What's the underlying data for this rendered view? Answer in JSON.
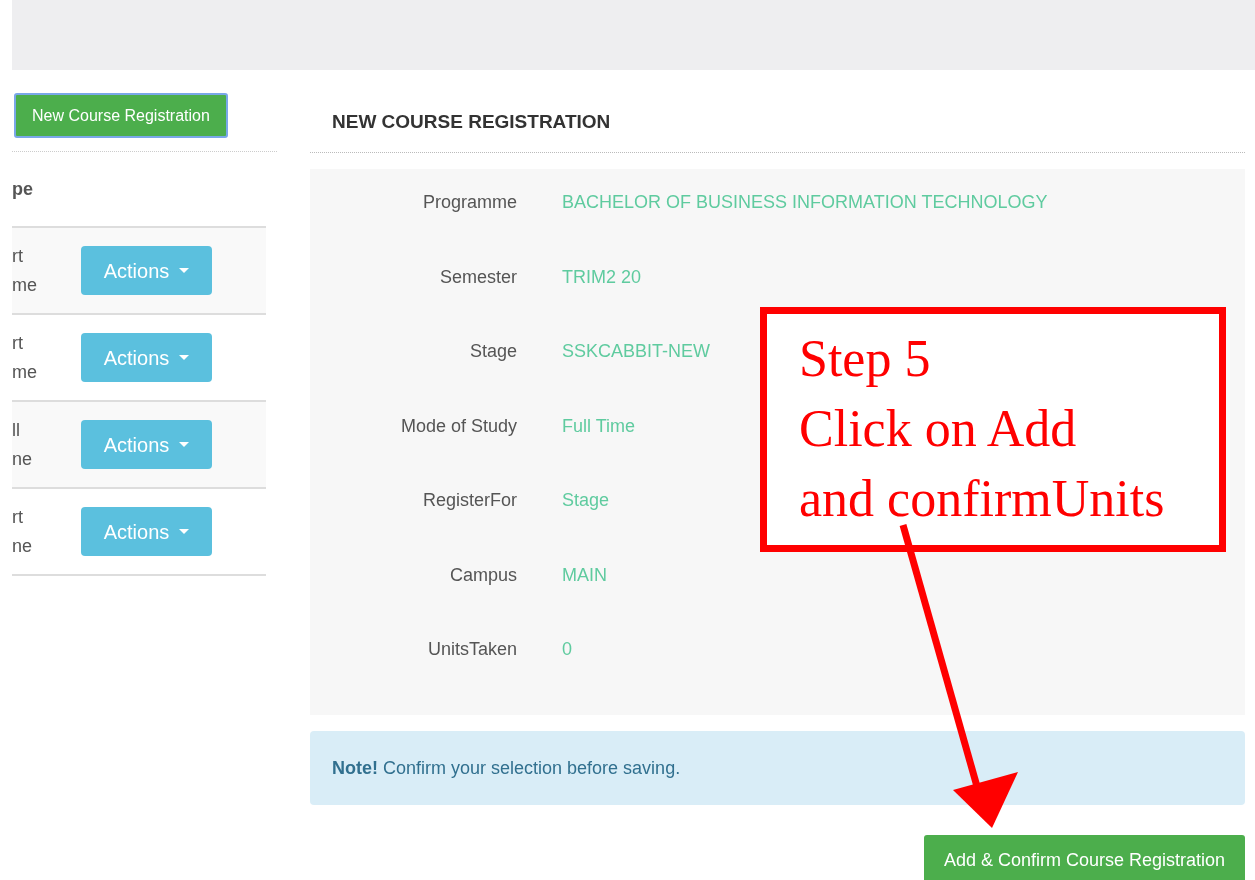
{
  "sidebar": {
    "new_button": "New Course Registration",
    "table": {
      "columns": [
        "pe"
      ],
      "rows": [
        {
          "lines": [
            "rt",
            "me"
          ],
          "action": "Actions"
        },
        {
          "lines": [
            "rt",
            "me"
          ],
          "action": "Actions"
        },
        {
          "lines": [
            "ll",
            "ne"
          ],
          "action": "Actions"
        },
        {
          "lines": [
            "rt",
            "ne"
          ],
          "action": "Actions"
        }
      ]
    }
  },
  "panel": {
    "title": "NEW COURSE REGISTRATION",
    "fields": [
      {
        "label": "Programme",
        "value": "BACHELOR OF BUSINESS INFORMATION TECHNOLOGY"
      },
      {
        "label": "Semester",
        "value": "TRIM2 20"
      },
      {
        "label": "Stage",
        "value": "SSKCABBIT-NEW"
      },
      {
        "label": "Mode of Study",
        "value": "Full Time"
      },
      {
        "label": "RegisterFor",
        "value": "Stage"
      },
      {
        "label": "Campus",
        "value": "MAIN"
      },
      {
        "label": "UnitsTaken",
        "value": "0"
      }
    ],
    "note": "**Note!** Confirm your selection before saving.",
    "submit_button": "Add & Confirm Course Registration"
  },
  "annotation": {
    "lines": [
      "Step 5",
      "Click on Add",
      "and confirmUnits"
    ]
  }
}
